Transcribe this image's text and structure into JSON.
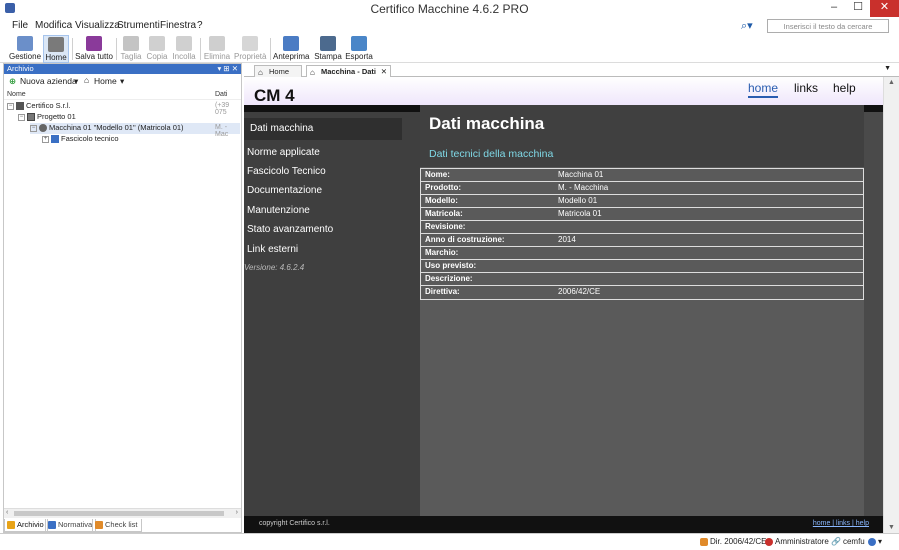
{
  "window": {
    "title": "Certifico Macchine 4.6.2 PRO",
    "minimize": "–",
    "maximize": "☐",
    "close": "✕"
  },
  "menu": [
    "File",
    "Modifica",
    "Visualizza",
    "Strumenti",
    "Finestra",
    "?"
  ],
  "search": {
    "placeholder": "Inserisci il testo da cercare"
  },
  "toolbar": {
    "gestione": "Gestione",
    "home": "Home",
    "salva_tutto": "Salva tutto",
    "taglia": "Taglia",
    "copia": "Copia",
    "incolla": "Incolla",
    "elimina": "Elimina",
    "proprieta": "Proprietà",
    "anteprima": "Anteprima",
    "stampa": "Stampa",
    "esporta": "Esporta"
  },
  "archive": {
    "header": "Archivio",
    "controls": "▾ ⊞ ✕",
    "new_company": "Nuova azienda",
    "home": "Home",
    "col_name": "Nome",
    "col_data": "Dati",
    "tree": [
      {
        "label": "Certifico S.r.l.",
        "value": "(+39 075"
      },
      {
        "label": "Progetto 01",
        "value": ""
      },
      {
        "label": "Macchina 01 \"Modello 01\" (Matricola 01)",
        "value": "M. - Mac"
      },
      {
        "label": "Fascicolo tecnico",
        "value": ""
      }
    ],
    "tabs": [
      "Archivio",
      "Normativa",
      "Check list"
    ]
  },
  "doc_tabs": {
    "home": "Home",
    "active": "Macchina - Dati"
  },
  "site": {
    "logo": "CM 4",
    "nav": [
      "home",
      "links",
      "help"
    ],
    "sidebar": [
      "Dati macchina",
      "Norme applicate",
      "Fascicolo Tecnico",
      "Documentazione",
      "Manutenzione",
      "Stato avanzamento",
      "Link esterni"
    ],
    "version": "Versione: 4.6.2.4",
    "title": "Dati macchina",
    "subtitle": "Dati tecnici della macchina",
    "rows": [
      {
        "k": "Nome:",
        "v": "Macchina 01"
      },
      {
        "k": "Prodotto:",
        "v": "M. - Macchina"
      },
      {
        "k": "Modello:",
        "v": "Modello 01"
      },
      {
        "k": "Matricola:",
        "v": "Matricola 01"
      },
      {
        "k": "Revisione:",
        "v": ""
      },
      {
        "k": "Anno di costruzione:",
        "v": "2014"
      },
      {
        "k": "Marchio:",
        "v": ""
      },
      {
        "k": "Uso previsto:",
        "v": ""
      },
      {
        "k": "Descrizione:",
        "v": ""
      },
      {
        "k": "Direttiva:",
        "v": "2006/42/CE"
      }
    ],
    "copyright": "copyright Certifico s.r.l.",
    "footer_links": "home | links | help"
  },
  "status": {
    "directive": "Dir. 2006/42/CE",
    "user": "Amministratore",
    "login": "cemfu"
  },
  "colors": {
    "accent": "#2a5db0",
    "panel_header": "#3a6fc4",
    "content_bg": "#4a4a4a",
    "subtitle": "#7fd8e6"
  }
}
